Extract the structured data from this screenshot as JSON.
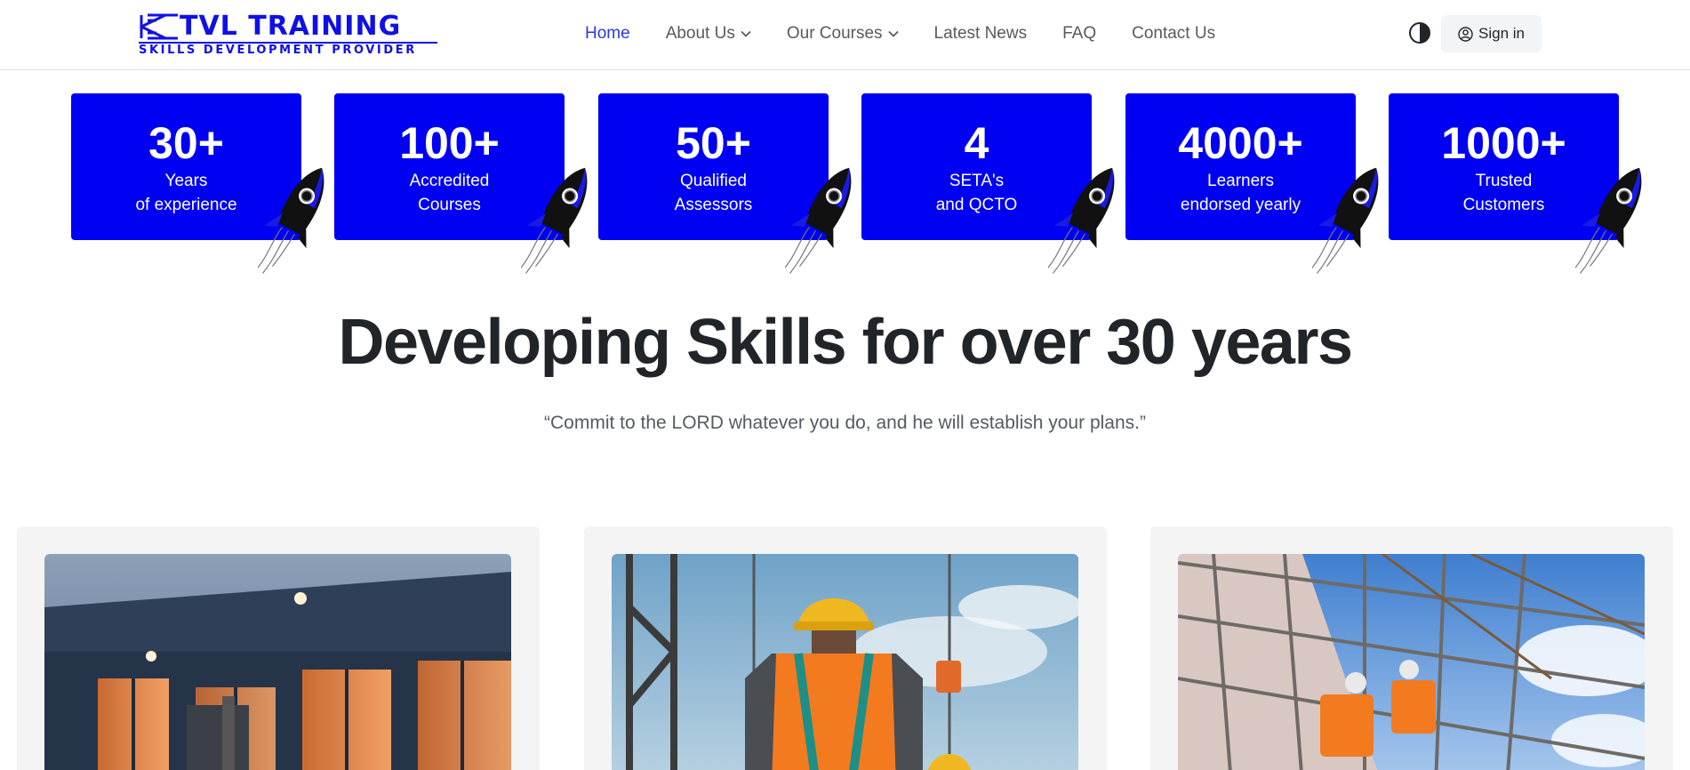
{
  "header": {
    "logo": {
      "title": "TVL TRAINING",
      "subtitle": "SKILLS DEVELOPMENT PROVIDER"
    },
    "nav": [
      {
        "label": "Home",
        "active": true,
        "dropdown": false
      },
      {
        "label": "About Us",
        "active": false,
        "dropdown": true
      },
      {
        "label": "Our Courses",
        "active": false,
        "dropdown": true
      },
      {
        "label": "Latest News",
        "active": false,
        "dropdown": false
      },
      {
        "label": "FAQ",
        "active": false,
        "dropdown": false
      },
      {
        "label": "Contact Us",
        "active": false,
        "dropdown": false
      }
    ],
    "theme_toggle_icon": "contrast-icon",
    "signin": {
      "label": "Sign in",
      "icon": "user-circle-icon"
    }
  },
  "stats": [
    {
      "value": "30+",
      "line1": "Years",
      "line2": "of experience"
    },
    {
      "value": "100+",
      "line1": "Accredited",
      "line2": "Courses"
    },
    {
      "value": "50+",
      "line1": "Qualified",
      "line2": "Assessors"
    },
    {
      "value": "4",
      "line1": "SETA's",
      "line2": "and QCTO"
    },
    {
      "value": "4000+",
      "line1": "Learners",
      "line2": "endorsed yearly"
    },
    {
      "value": "1000+",
      "line1": "Trusted",
      "line2": "Customers"
    }
  ],
  "hero": {
    "title": "Developing Skills for over 30 years",
    "quote": "“Commit to the LORD whatever you do, and he will establish your plans.”"
  },
  "cards": [
    {
      "image": "forklift-warehouse-image"
    },
    {
      "image": "construction-worker-harness-image"
    },
    {
      "image": "scaffolding-workers-image"
    }
  ],
  "colors": {
    "brand_blue": "#0000f2",
    "logo_blue": "#1010e6",
    "nav_active": "#2d37e0",
    "nav_text": "#555b61",
    "card_bg": "#f4f4f4"
  }
}
